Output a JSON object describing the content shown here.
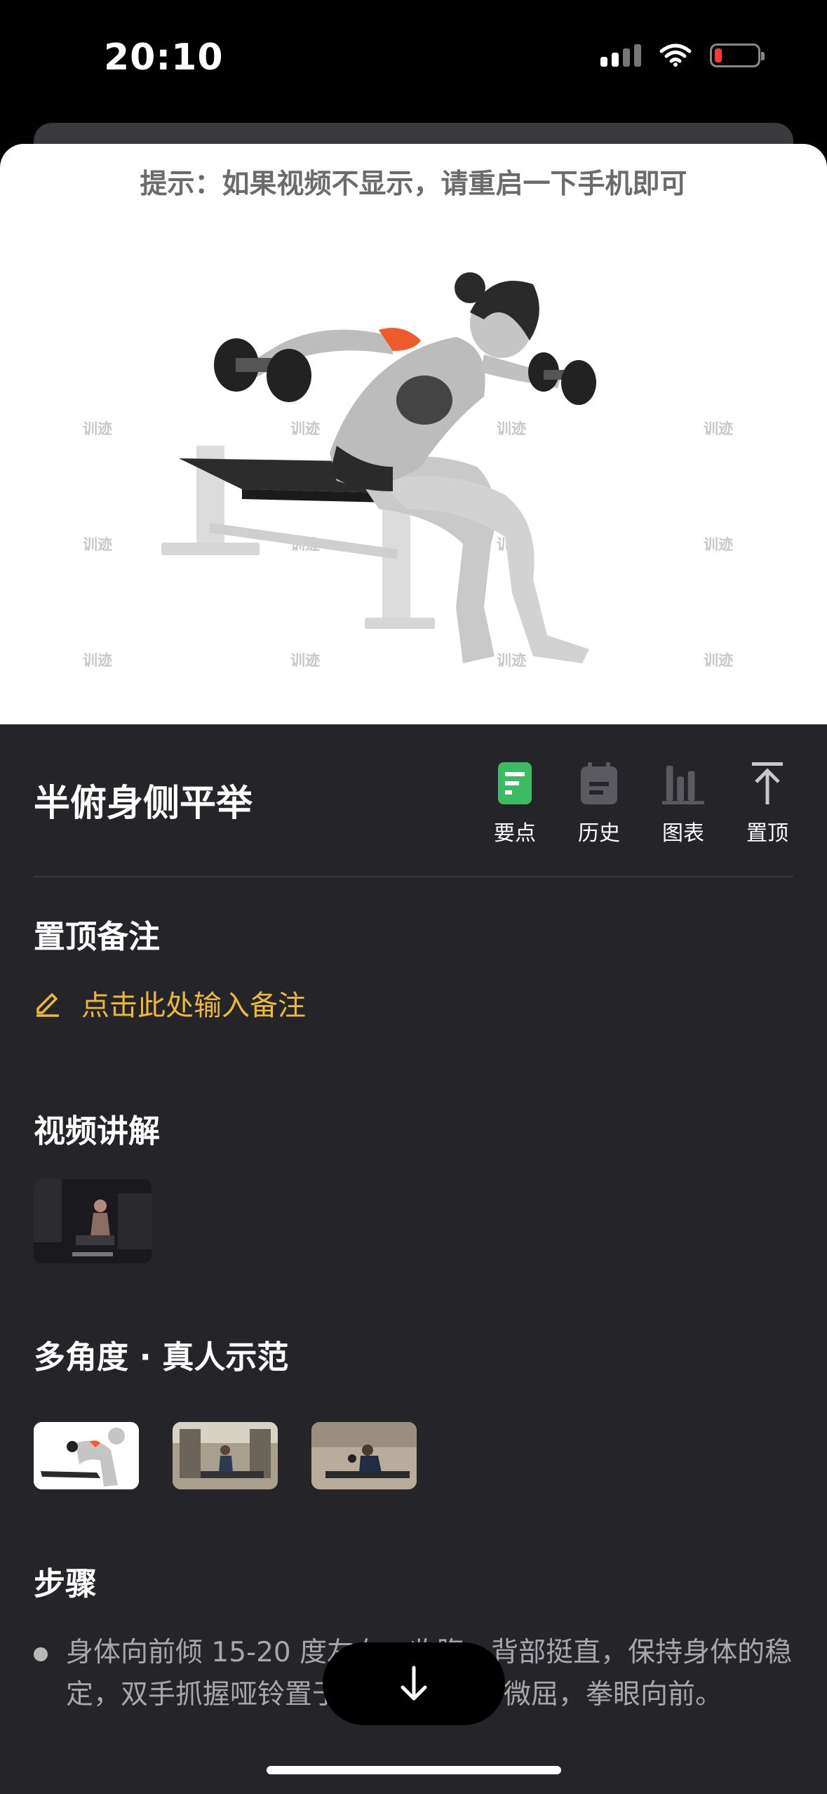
{
  "status": {
    "time": "20:10"
  },
  "sheet": {
    "hint": "提示：如果视频不显示，请重启一下手机即可"
  },
  "watermark": "训迹",
  "exercise": {
    "title": "半俯身侧平举"
  },
  "toolbar": [
    {
      "label": "要点",
      "icon": "doc-list-icon",
      "active": true
    },
    {
      "label": "历史",
      "icon": "calendar-icon"
    },
    {
      "label": "图表",
      "icon": "bar-chart-icon"
    },
    {
      "label": "置顶",
      "icon": "pin-top-icon"
    }
  ],
  "pinned_note": {
    "title": "置顶备注",
    "placeholder": "点击此处输入备注"
  },
  "video": {
    "title": "视频讲解"
  },
  "multi_angle": {
    "title": "多角度 · 真人示范"
  },
  "steps": {
    "title": "步骤",
    "items": [
      "身体向前倾 15-20 度左右，收腹，背部挺直，保持身体的稳定，双手抓握哑铃置于身体两侧，肘微屈，拳眼向前。"
    ]
  },
  "colors": {
    "accent_green": "#3dbb64",
    "note_yellow": "#e8b93a",
    "dark_bg": "#252429"
  }
}
